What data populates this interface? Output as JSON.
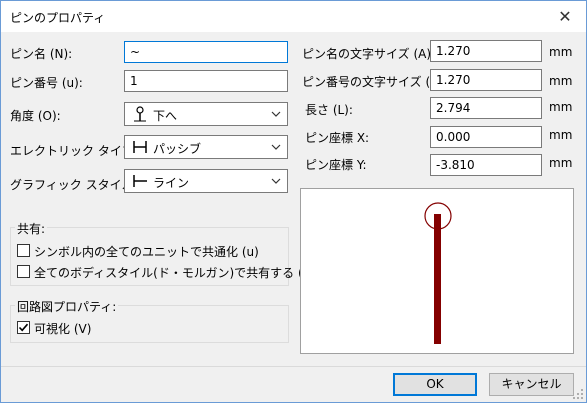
{
  "window": {
    "title": "ピンのプロパティ",
    "close_glyph": "✕"
  },
  "left": {
    "pin_name": {
      "label": "ピン名 (N):",
      "value": "~"
    },
    "pin_number": {
      "label": "ピン番号 (u):",
      "value": "1"
    },
    "orientation": {
      "label": "角度 (O):",
      "value": "下へ",
      "icon": "pin-down-icon"
    },
    "electrical_type": {
      "label": "エレクトリック タイプ (E):",
      "value": "パッシブ",
      "icon": "passive-pin-icon"
    },
    "graphic_style": {
      "label": "グラフィック スタイル (S):",
      "value": "ライン",
      "icon": "line-pin-icon"
    }
  },
  "right": {
    "name_text_size": {
      "label": "ピン名の文字サイズ (A):",
      "value": "1.270",
      "unit": "mm"
    },
    "number_text_size": {
      "label": "ピン番号の文字サイズ (X):",
      "value": "1.270",
      "unit": "mm"
    },
    "length": {
      "label": "長さ (L):",
      "value": "2.794",
      "unit": "mm"
    },
    "pos_x": {
      "label": "ピン座標 X:",
      "value": "0.000",
      "unit": "mm"
    },
    "pos_y": {
      "label": "ピン座標 Y:",
      "value": "-3.810",
      "unit": "mm"
    }
  },
  "shared": {
    "title": "共有:",
    "common_units": {
      "label": "シンボル内の全てのユニットで共通化 (u)",
      "checked": false
    },
    "common_body_style": {
      "label": "全てのボディスタイル(ド・モルガン)で共有する (S)",
      "checked": false
    }
  },
  "schematic": {
    "title": "回路図プロパティ:",
    "visible": {
      "label": "可視化 (V)",
      "checked": true
    }
  },
  "buttons": {
    "ok": "OK",
    "cancel": "キャンセル"
  },
  "colors": {
    "accent": "#0078d7",
    "pin": "#840000",
    "pin_end": "#840000"
  }
}
